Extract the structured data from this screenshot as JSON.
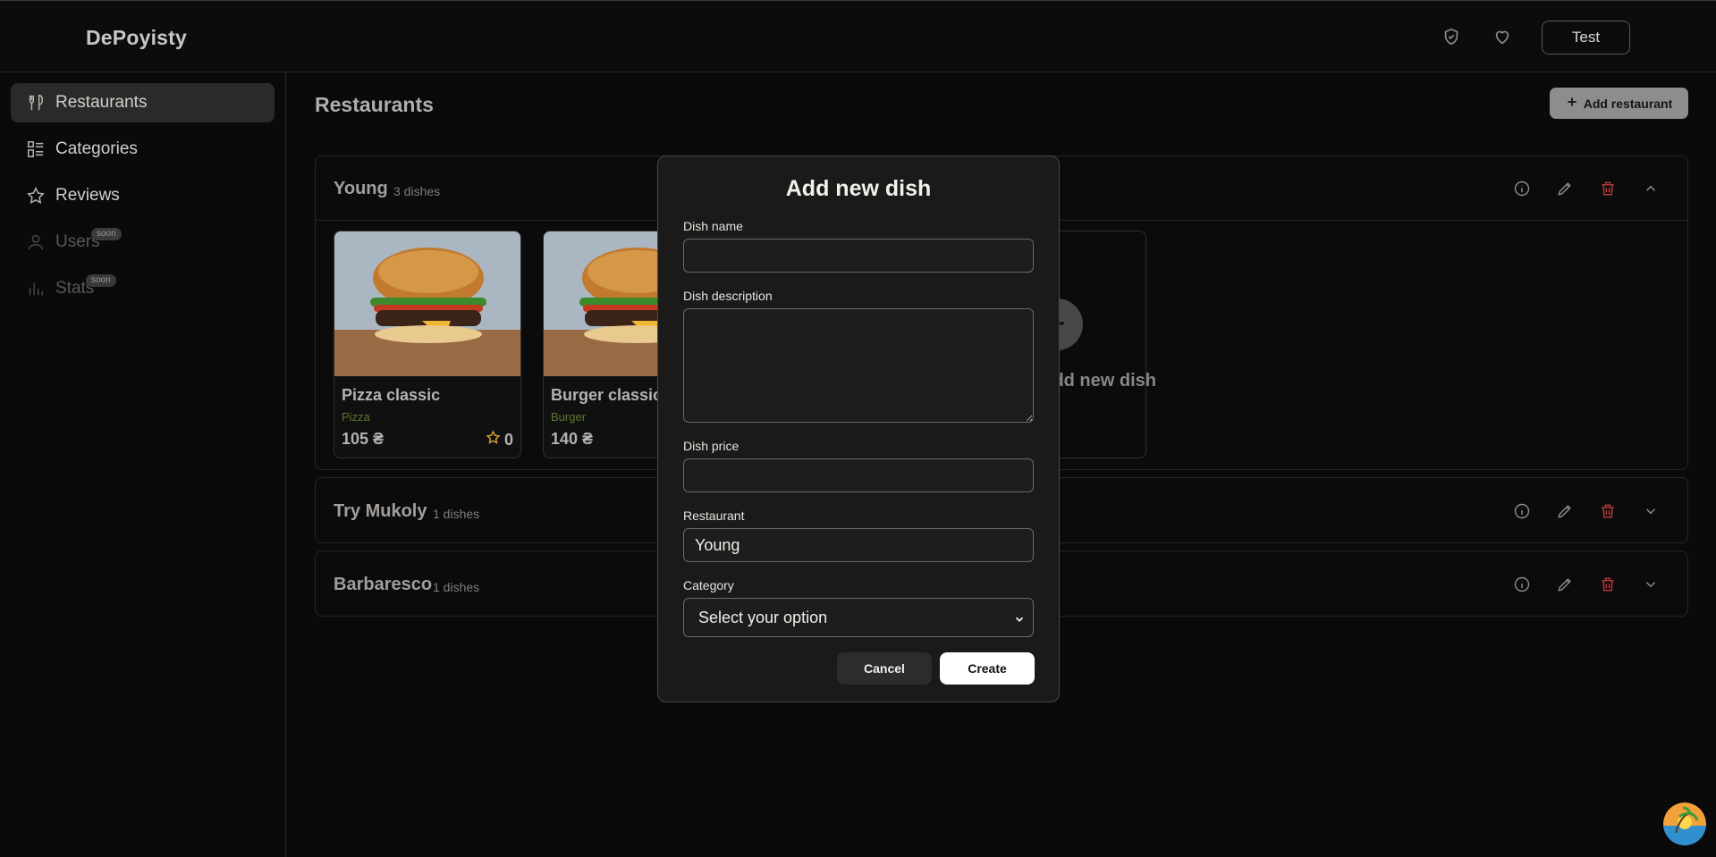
{
  "header": {
    "logo": "DePoyisty",
    "user_button": "Test",
    "icons": [
      "shield-check-icon",
      "heart-icon"
    ]
  },
  "sidebar": {
    "items": [
      {
        "label": "Restaurants",
        "icon": "fork-knife-icon",
        "active": true
      },
      {
        "label": "Categories",
        "icon": "list-grid-icon"
      },
      {
        "label": "Reviews",
        "icon": "star-icon"
      },
      {
        "label": "Users",
        "icon": "user-icon",
        "badge": "soon",
        "disabled": true
      },
      {
        "label": "Stats",
        "icon": "bar-chart-icon",
        "badge": "soon",
        "disabled": true
      }
    ]
  },
  "main": {
    "title": "Restaurants",
    "add_button": "Add restaurant",
    "restaurants": [
      {
        "name": "Young",
        "count": "3 dishes",
        "expanded": true,
        "dishes": [
          {
            "name": "Pizza classic",
            "category": "Pizza",
            "price": "105 ₴",
            "rating": "0"
          },
          {
            "name": "Burger classic",
            "category": "Burger",
            "price": "140 ₴"
          }
        ],
        "add_dish_label": "Add new dish"
      },
      {
        "name": "Try Mukoly",
        "count": "1 dishes",
        "expanded": false
      },
      {
        "name": "Barbaresco",
        "count": "1 dishes",
        "expanded": false
      }
    ]
  },
  "modal": {
    "title": "Add new dish",
    "fields": {
      "name_label": "Dish name",
      "name_value": "",
      "description_label": "Dish description",
      "description_value": "",
      "price_label": "Dish price",
      "price_value": "",
      "restaurant_label": "Restaurant",
      "restaurant_value": "Young",
      "category_label": "Category",
      "category_value": "Select your option"
    },
    "cancel": "Cancel",
    "create": "Create"
  },
  "colors": {
    "background": "#0b0a0a",
    "modal": "#1c1a19",
    "danger": "#c0393b",
    "category_green": "#5b7a2e"
  }
}
